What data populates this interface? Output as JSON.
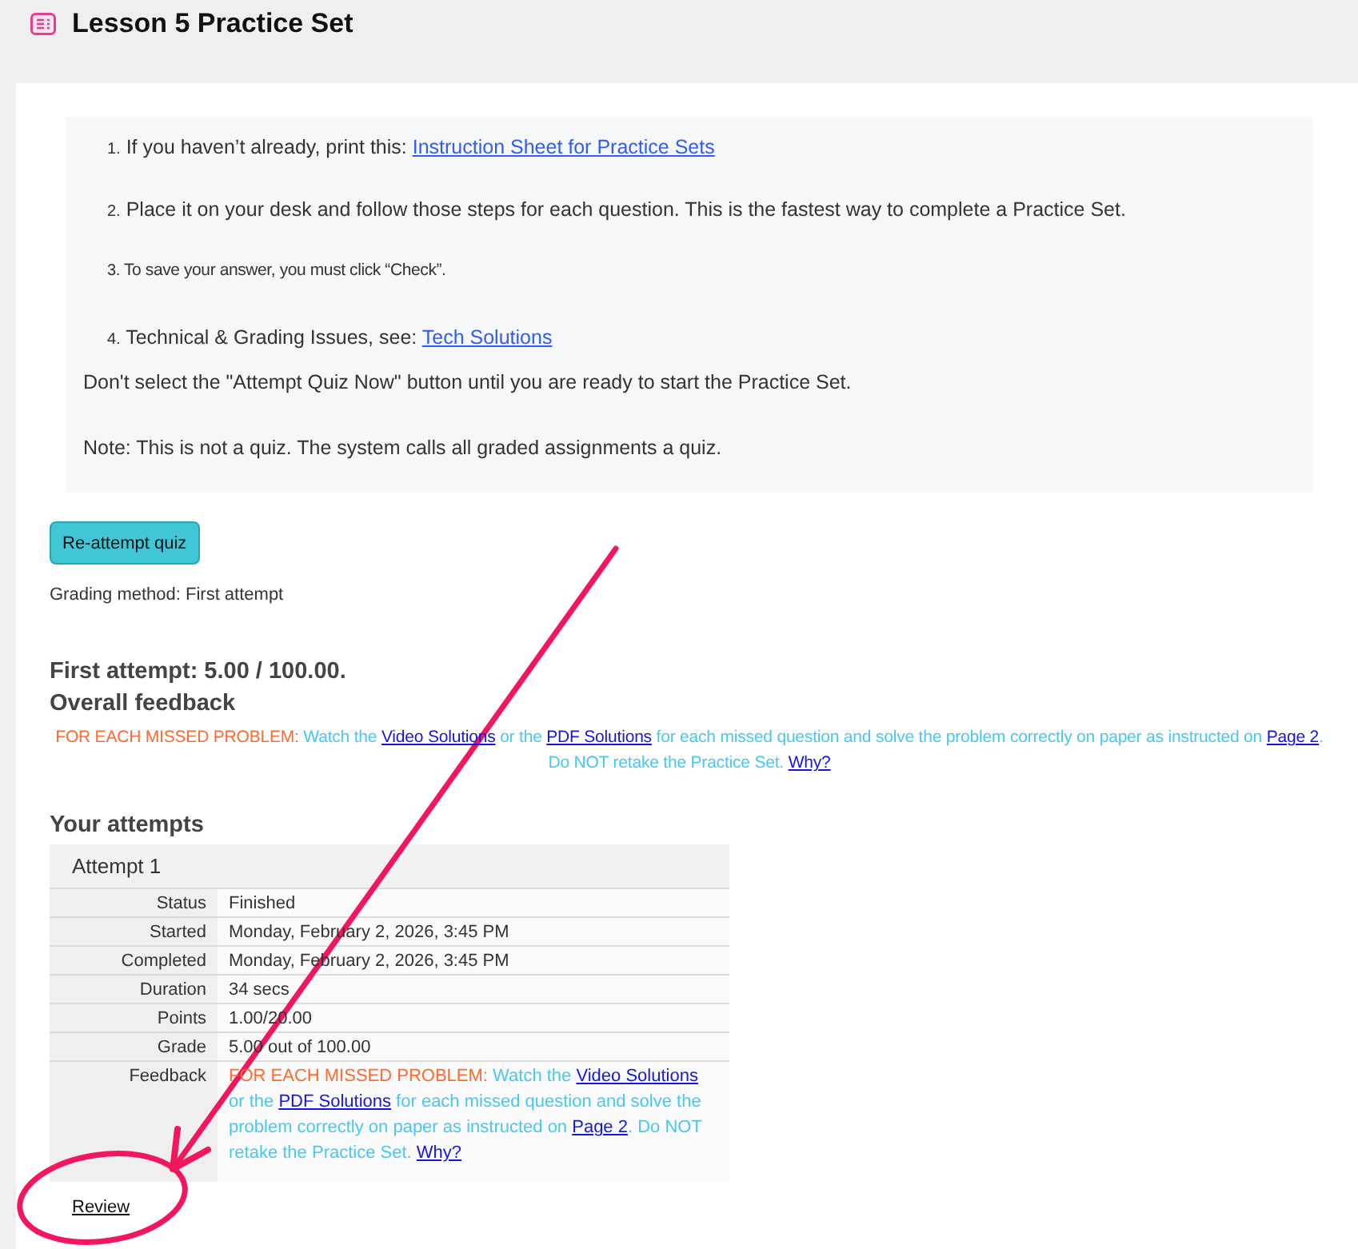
{
  "page": {
    "title": "Lesson 5 Practice Set"
  },
  "instructions": {
    "steps": [
      {
        "number": "1.",
        "small": false,
        "parts": [
          {
            "kind": "text",
            "text": "If you haven’t already, print this: "
          },
          {
            "kind": "link",
            "text": "Instruction Sheet for Practice Sets"
          }
        ]
      },
      {
        "number": "2.",
        "small": false,
        "parts": [
          {
            "kind": "text",
            "text": "Place it on your desk and follow those steps for each question. This is the fastest way to complete a Practice Set."
          }
        ]
      },
      {
        "number": "3.",
        "small": true,
        "parts": [
          {
            "kind": "text",
            "text": "To save your answer, you must click “Check”."
          }
        ]
      },
      {
        "number": "4.",
        "small": false,
        "parts": [
          {
            "kind": "text",
            "text": "Technical & Grading Issues, see: "
          },
          {
            "kind": "link",
            "text": "Tech Solutions"
          }
        ]
      }
    ],
    "notes": [
      "Don't select the \"Attempt Quiz Now\" button until you are ready to start the Practice Set.",
      "Note: This is not a quiz. The system calls all graded assignments a quiz."
    ]
  },
  "reattempt_button": {
    "label": "Re-attempt quiz"
  },
  "grading_method": "Grading method: First attempt",
  "summary": {
    "result": "First attempt: 5.00 / 100.00.",
    "feedback_heading": "Overall feedback",
    "feedback": [
      {
        "kind": "lead",
        "text": "FOR EACH MISSED PROBLEM:"
      },
      {
        "kind": "text",
        "text": " Watch the "
      },
      {
        "kind": "link",
        "text": "Video Solutions"
      },
      {
        "kind": "text",
        "text": " or the "
      },
      {
        "kind": "link",
        "text": "PDF Solutions"
      },
      {
        "kind": "text",
        "text": " for each missed question and solve the problem correctly on paper as instructed on "
      },
      {
        "kind": "link",
        "text": "Page 2"
      },
      {
        "kind": "text",
        "text": ". Do NOT retake the Practice Set. "
      },
      {
        "kind": "link",
        "text": "Why?"
      }
    ]
  },
  "attempts": {
    "heading": "Your attempts",
    "table": {
      "title": "Attempt 1",
      "rows": [
        {
          "kind": "text",
          "label": "Status",
          "value": "Finished"
        },
        {
          "kind": "text",
          "label": "Started",
          "value": "Monday, February 2, 2026, 3:45 PM"
        },
        {
          "kind": "text",
          "label": "Completed",
          "value": "Monday, February 2, 2026, 3:45 PM"
        },
        {
          "kind": "text",
          "label": "Duration",
          "value": "34 secs"
        },
        {
          "kind": "text",
          "label": "Points",
          "value": "1.00/20.00"
        },
        {
          "kind": "text",
          "label": "Grade",
          "value": "5.00 out of 100.00"
        },
        {
          "kind": "feedback",
          "label": "Feedback",
          "parts": [
            {
              "kind": "lead",
              "text": "FOR EACH MISSED PROBLEM:"
            },
            {
              "kind": "text",
              "text": " Watch the "
            },
            {
              "kind": "link",
              "text": "Video Solutions"
            },
            {
              "kind": "text",
              "text": " or the "
            },
            {
              "kind": "link",
              "text": "PDF Solutions"
            },
            {
              "kind": "text",
              "text": " for each missed question and solve the problem correctly on paper as instructed on "
            },
            {
              "kind": "link",
              "text": "Page 2"
            },
            {
              "kind": "text",
              "text": ". Do NOT retake the Practice Set. "
            },
            {
              "kind": "link",
              "text": "Why?"
            }
          ]
        }
      ]
    }
  },
  "review_link": "Review",
  "annotations": {
    "arrow": true,
    "circle": true
  }
}
